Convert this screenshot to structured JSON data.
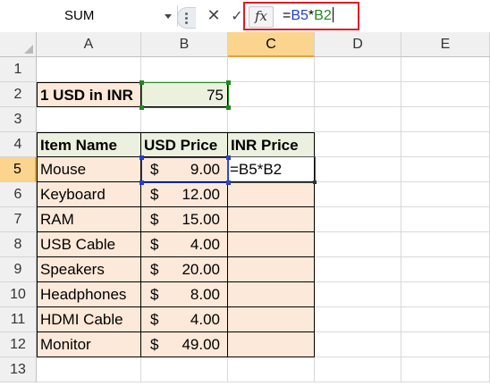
{
  "formula_bar": {
    "name_box": "SUM",
    "cancel_icon": "✕",
    "enter_icon": "✓",
    "fx_label": "fx",
    "formula": {
      "eq": "=",
      "ref1": "B5",
      "op": "*",
      "ref2": "B2"
    }
  },
  "columns": [
    "A",
    "B",
    "C",
    "D",
    "E"
  ],
  "rows": [
    "1",
    "2",
    "3",
    "4",
    "5",
    "6",
    "7",
    "8",
    "9",
    "10",
    "11",
    "12",
    "13"
  ],
  "sheet": {
    "rate_label": "1 USD in INR",
    "rate_value": "75",
    "headers": {
      "item": "Item Name",
      "usd": "USD Price",
      "inr": "INR Price"
    },
    "currency_symbol": "$",
    "items": [
      {
        "name": "Mouse",
        "usd": "9.00"
      },
      {
        "name": "Keyboard",
        "usd": "12.00"
      },
      {
        "name": "RAM",
        "usd": "15.00"
      },
      {
        "name": "USB Cable",
        "usd": "4.00"
      },
      {
        "name": "Speakers",
        "usd": "20.00"
      },
      {
        "name": "Headphones",
        "usd": "8.00"
      },
      {
        "name": "HDMI Cable",
        "usd": "4.00"
      },
      {
        "name": "Monitor",
        "usd": "49.00"
      }
    ],
    "editing_cell_text": "=B5*B2"
  },
  "colors": {
    "highlight_red": "#e01b24",
    "ref_blue": "#1f3fd6",
    "ref_green": "#1f8a1f",
    "peach_fill": "#fde9d9",
    "green_fill": "#ebf1de",
    "active_header": "#fbd58d"
  }
}
